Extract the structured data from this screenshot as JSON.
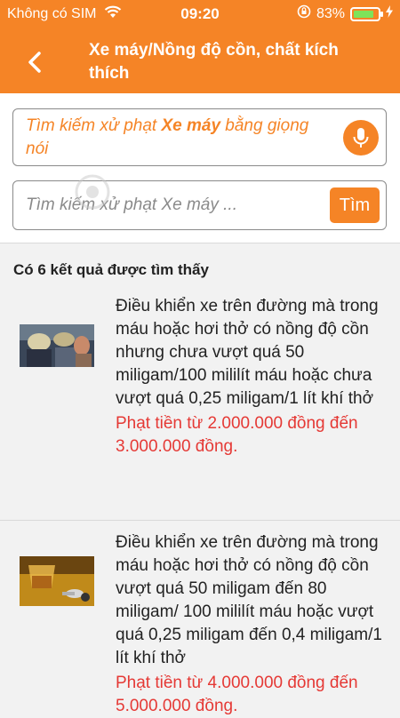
{
  "status_bar": {
    "carrier": "Không có SIM",
    "time": "09:20",
    "battery_percent": "83%",
    "battery_level": 0.83,
    "wifi_icon": "wifi-icon",
    "lock_rotation_icon": "orientation-lock-icon",
    "charging_icon": "charging-icon"
  },
  "header": {
    "title": "Xe máy/Nồng độ cồn, chất kích thích",
    "back_icon": "chevron-left-icon",
    "color": "#f58426"
  },
  "voice_search": {
    "prefix": "Tìm kiếm xử phạt ",
    "bold": "Xe máy",
    "suffix": " bằng giọng nói",
    "mic_icon": "microphone-icon"
  },
  "text_search": {
    "placeholder": "Tìm kiếm xử phạt Xe máy ...",
    "value": "",
    "button_label": "Tìm"
  },
  "watermark": "Quantrimang",
  "results_count": "Có 6 kết quả được tìm thấy",
  "results": [
    {
      "thumb": "police-checkpoint-photo",
      "description": "Điều khiển xe trên đường mà trong máu hoặc hơi thở có nồng độ cồn nhưng chưa vượt quá 50 miligam/100 mililít máu hoặc chưa vượt quá 0,25 miligam/1 lít khí thở",
      "fine": "Phạt tiền từ 2.000.000 đồng đến 3.000.000 đồng."
    },
    {
      "thumb": "alcohol-and-keys-photo",
      "description": "Điều khiển xe trên đường mà trong máu hoặc hơi thở có nồng độ cồn vượt quá 50 miligam đến 80 miligam/ 100 mililít máu hoặc vượt quá 0,25 miligam đến 0,4 miligam/1 lít khí thở",
      "fine": "Phạt tiền từ 4.000.000 đồng đến 5.000.000 đồng."
    }
  ]
}
